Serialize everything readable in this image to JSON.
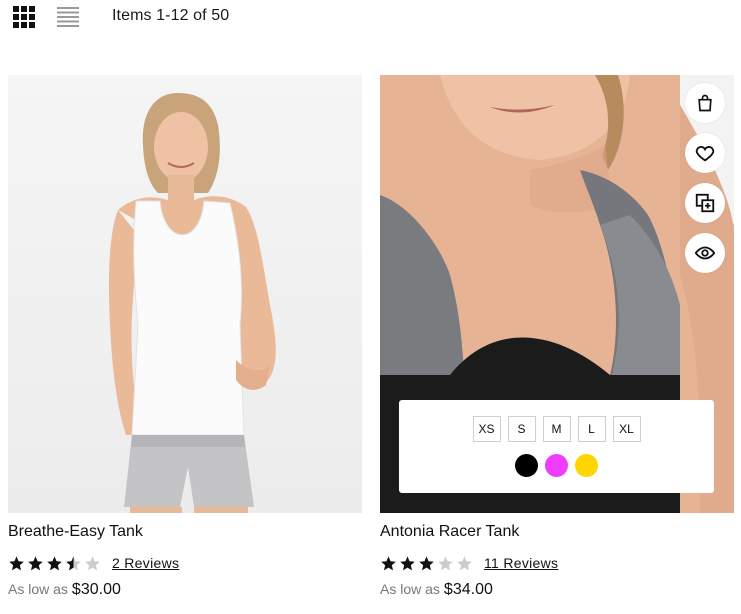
{
  "toolbar": {
    "view_grid_icon": "grid-view-icon",
    "view_list_icon": "list-view-icon",
    "items_count": "Items 1-12 of 50"
  },
  "products": [
    {
      "name": "Breathe-Easy Tank",
      "rating_stars": 3.5,
      "rating_max": 5,
      "reviews_label": "2  Reviews",
      "price_prefix": "As low as",
      "price": "$30.00",
      "image": "woman-white-tank-photo"
    },
    {
      "name": "Antonia Racer Tank",
      "rating_stars": 3,
      "rating_max": 5,
      "reviews_label": "11  Reviews",
      "price_prefix": "As low as",
      "price": "$34.00",
      "image": "woman-gray-racer-tank-photo",
      "hover_actions": [
        "add-to-cart-icon",
        "wishlist-heart-icon",
        "compare-icon",
        "quick-view-eye-icon"
      ],
      "sizes": [
        "XS",
        "S",
        "M",
        "L",
        "XL"
      ],
      "colors": [
        "#000000",
        "#ef3dff",
        "#ffd500"
      ]
    }
  ],
  "colors": {
    "star_filled": "#111111",
    "star_empty": "#cccccc",
    "muted_text": "#777777"
  }
}
